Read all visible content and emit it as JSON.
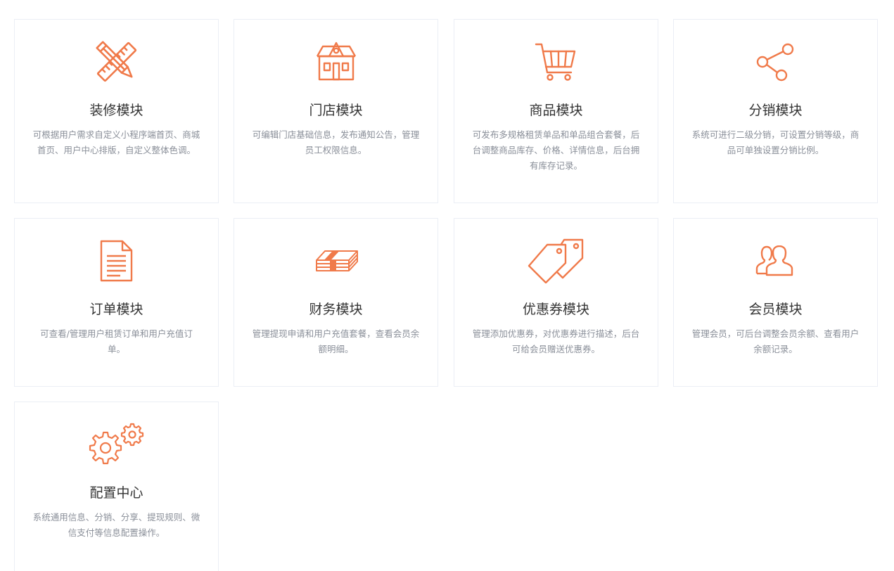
{
  "accent_color": "#f07a4a",
  "modules": [
    {
      "title": "装修模块",
      "desc_lines": [
        "可根据用户需求自定义小程序端首页、商城",
        "首页、用户中心排版，自定义整体色调。"
      ],
      "icon": "design-tools-icon"
    },
    {
      "title": "门店模块",
      "desc_lines": [
        "可编辑门店基础信息，发布通知公告，管理",
        "员工权限信息。"
      ],
      "icon": "store-icon"
    },
    {
      "title": "商品模块",
      "desc_lines": [
        "可发布多规格租赁单品和单品组合套餐，后",
        "台调整商品库存、价格、详情信息，后台拥",
        "有库存记录。"
      ],
      "icon": "shopping-cart-icon"
    },
    {
      "title": "分销模块",
      "desc_lines": [
        "系统可进行二级分销，可设置分销等级，商",
        "品可单独设置分销比例。"
      ],
      "icon": "share-icon"
    },
    {
      "title": "订单模块",
      "desc_lines": [
        "可查看/管理用户租赁订单和用户充值订",
        "单。"
      ],
      "icon": "document-icon"
    },
    {
      "title": "财务模块",
      "desc_lines": [
        "管理提现申请和用户充值套餐，查看会员余",
        "额明细。"
      ],
      "icon": "money-stack-icon"
    },
    {
      "title": "优惠券模块",
      "desc_lines": [
        "管理添加优惠券，对优惠券进行描述，后台",
        "可给会员赠送优惠券。"
      ],
      "icon": "price-tags-icon"
    },
    {
      "title": "会员模块",
      "desc_lines": [
        "管理会员，可后台调整会员余额、查看用户",
        "余额记录。"
      ],
      "icon": "users-icon"
    },
    {
      "title": "配置中心",
      "desc_lines": [
        "系统通用信息、分销、分享、提现规则、微",
        "信支付等信息配置操作。"
      ],
      "icon": "gears-icon"
    }
  ]
}
